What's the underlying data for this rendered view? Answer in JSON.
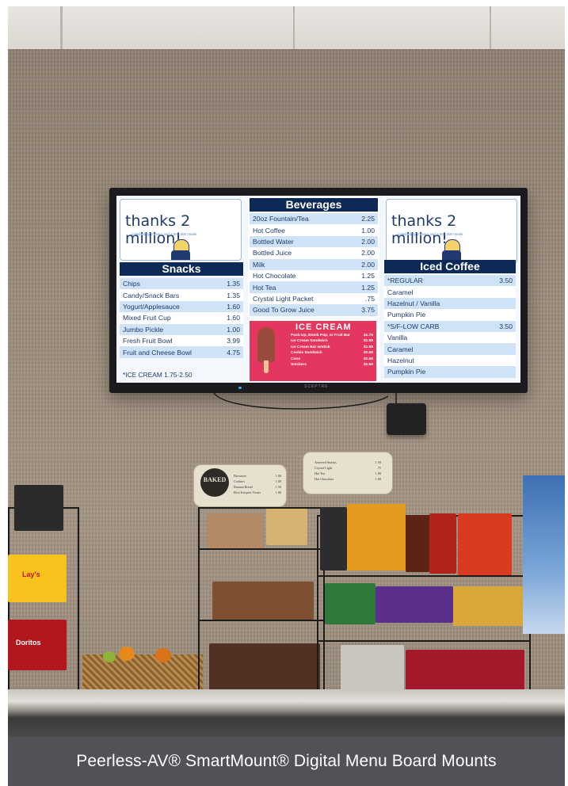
{
  "caption": "Peerless-AV® SmartMount® Digital Menu Board Mounts",
  "menu": {
    "logo": {
      "text": "thanks 2 million!",
      "subtext": "Celebrating 2 years and 2,000,000 meals"
    },
    "snacks": {
      "title": "Snacks",
      "items": [
        {
          "name": "Chips",
          "price": "1.35"
        },
        {
          "name": "Candy/Snack Bars",
          "price": "1.35"
        },
        {
          "name": "Yogurt/Applesauce",
          "price": "1.60"
        },
        {
          "name": "Mixed Fruit Cup",
          "price": "1.60"
        },
        {
          "name": "Jumbo Pickle",
          "price": "1.00"
        },
        {
          "name": "Fresh Fruit Bowl",
          "price": "3.99"
        },
        {
          "name": "Fruit and Cheese Bowl",
          "price": "4.75"
        }
      ],
      "note": "*ICE CREAM 1.75-2.50"
    },
    "beverages": {
      "title": "Beverages",
      "items": [
        {
          "name": "20oz Fountain/Tea",
          "price": "2.25"
        },
        {
          "name": "Hot Coffee",
          "price": "1.00"
        },
        {
          "name": "Bottled Water",
          "price": "2.00"
        },
        {
          "name": "Bottled Juice",
          "price": "2.00"
        },
        {
          "name": "Milk",
          "price": "2.00"
        },
        {
          "name": "Hot Chocolate",
          "price": "1.25"
        },
        {
          "name": "Hot Tea",
          "price": "1.25"
        },
        {
          "name": "Crystal Light Packet",
          "price": ".75"
        },
        {
          "name": "Good To Grow Juice",
          "price": "3.75"
        }
      ]
    },
    "ice_cream": {
      "title": "ICE CREAM",
      "items": [
        {
          "name": "Push Up, Bomb Pop, or Fruit Bar",
          "price": "$1.75"
        },
        {
          "name": "Ice Cream Sandwich",
          "price": "$1.95"
        },
        {
          "name": "Ice Cream Bar w/stick",
          "price": "$1.95"
        },
        {
          "name": "Cookie Sandwich",
          "price": "$2.00"
        },
        {
          "name": "Cone",
          "price": "$2.00"
        },
        {
          "name": "Snickers",
          "price": "$2.50"
        }
      ]
    },
    "iced_coffee": {
      "title": "Iced Coffee",
      "items": [
        {
          "name": "*REGULAR",
          "price": "3.50"
        },
        {
          "name": "Caramel",
          "price": ""
        },
        {
          "name": "Hazelnut / Vanilla",
          "price": ""
        },
        {
          "name": "Pumpkin Pie",
          "price": ""
        },
        {
          "name": "*S/F-LOW CARB",
          "price": "3.50"
        },
        {
          "name": "Vanilla",
          "price": ""
        },
        {
          "name": "Caramel",
          "price": ""
        },
        {
          "name": "Hazelnut",
          "price": ""
        },
        {
          "name": "Pumpkin Pie",
          "price": ""
        }
      ]
    },
    "tv_brand": "SCEPTRE"
  },
  "signs": {
    "baked_seal": "BAKED",
    "baked_items": [
      {
        "name": "Brownies",
        "price": "1.00"
      },
      {
        "name": "Cookies",
        "price": "1.00"
      },
      {
        "name": "Banana Bread",
        "price": "1.50"
      },
      {
        "name": "Rice Krispies Treats",
        "price": "1.00"
      }
    ],
    "snack_items": [
      {
        "name": "Assorted Snacks",
        "price": "1.50"
      },
      {
        "name": "Crystal Light",
        "price": ".75"
      },
      {
        "name": "Hot Tea",
        "price": "1.00"
      },
      {
        "name": "Hot Chocolate",
        "price": "1.00"
      }
    ]
  },
  "products": {
    "bag_lays": "Lay's",
    "bag_doritos": "Doritos"
  },
  "colors": {
    "menu_navy": "#0c2a55",
    "row_blue": "#cfe2f6",
    "ice_cream_pink": "#e4375f",
    "caption_bar": "#515257"
  }
}
